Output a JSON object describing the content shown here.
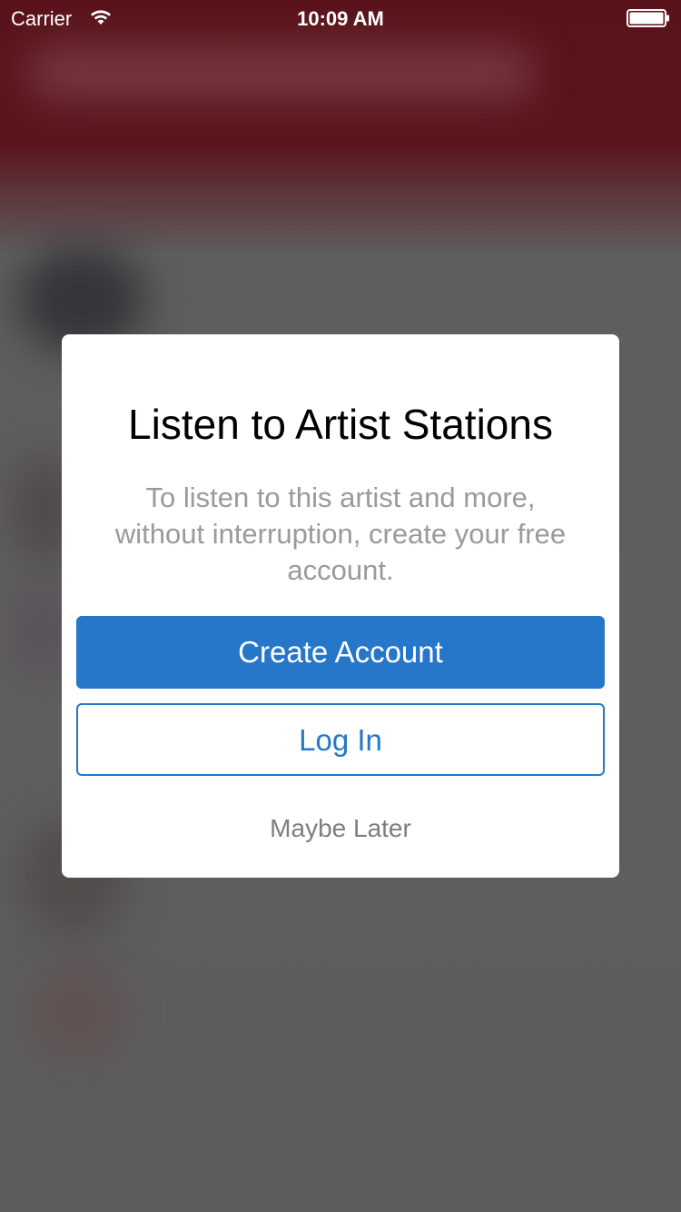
{
  "status_bar": {
    "carrier": "Carrier",
    "time": "10:09 AM",
    "wifi_icon": "wifi-icon",
    "battery_icon": "battery-icon"
  },
  "modal": {
    "title": "Listen to Artist Stations",
    "message": "To listen to this artist and more, without interruption, create your free account.",
    "create_account_label": "Create Account",
    "log_in_label": "Log In",
    "maybe_later_label": "Maybe Later"
  },
  "colors": {
    "accent": "#2676c9",
    "header_background": "#5a131b",
    "overlay_background": "#5e5e5e",
    "message_text": "#9a9a9a",
    "secondary_text": "#7e7e7e"
  }
}
